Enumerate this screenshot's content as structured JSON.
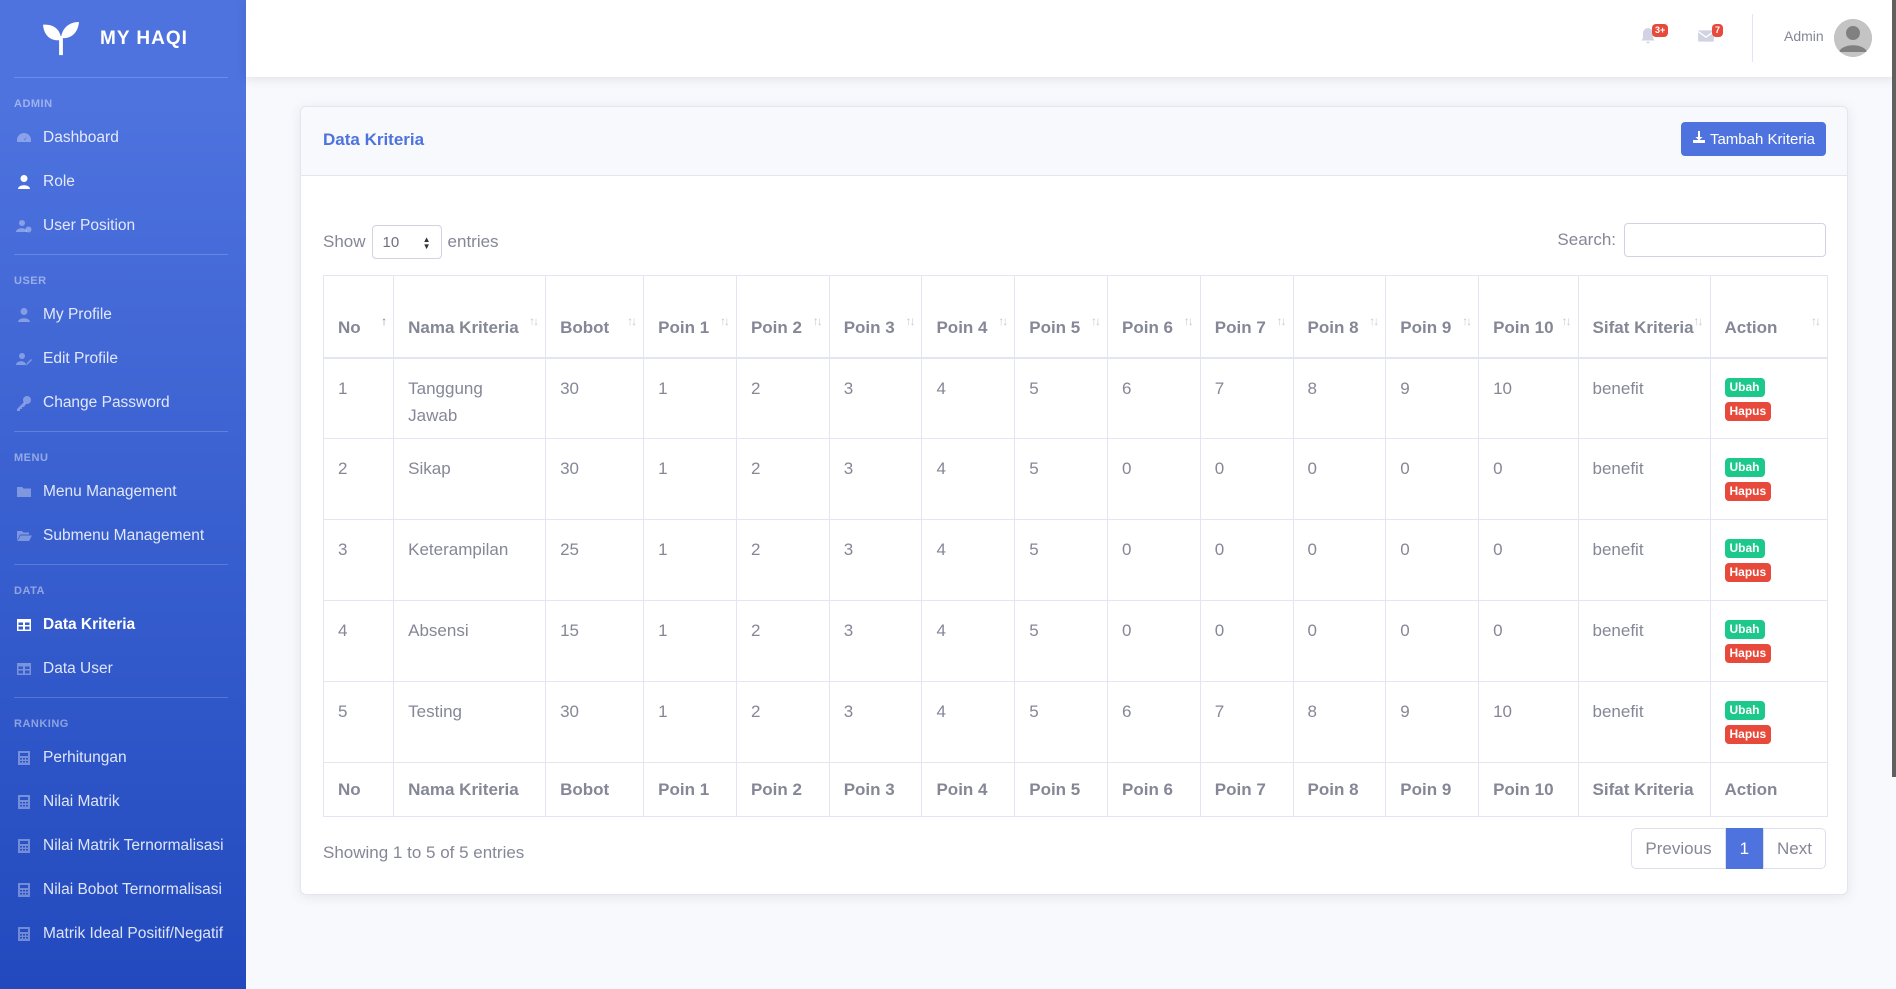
{
  "brand": {
    "name": "MY HAQI"
  },
  "sidebar": {
    "sections": [
      {
        "heading": "ADMIN",
        "items": [
          {
            "label": "Dashboard",
            "icon": "tachometer-icon"
          },
          {
            "label": "Role",
            "icon": "user-tie-icon"
          },
          {
            "label": "User Position",
            "icon": "users-cog-icon"
          }
        ]
      },
      {
        "heading": "USER",
        "items": [
          {
            "label": "My Profile",
            "icon": "user-icon"
          },
          {
            "label": "Edit Profile",
            "icon": "user-edit-icon"
          },
          {
            "label": "Change Password",
            "icon": "key-icon"
          }
        ]
      },
      {
        "heading": "MENU",
        "items": [
          {
            "label": "Menu Management",
            "icon": "folder-icon"
          },
          {
            "label": "Submenu Management",
            "icon": "folder-open-icon"
          }
        ]
      },
      {
        "heading": "DATA",
        "items": [
          {
            "label": "Data Kriteria",
            "icon": "table-icon"
          },
          {
            "label": "Data User",
            "icon": "table-icon"
          }
        ]
      },
      {
        "heading": "RANKING",
        "items": [
          {
            "label": "Perhitungan",
            "icon": "calculator-icon"
          },
          {
            "label": "Nilai Matrik",
            "icon": "calculator-icon"
          },
          {
            "label": "Nilai Matrik Ternormalisasi",
            "icon": "calculator-icon"
          },
          {
            "label": "Nilai Bobot Ternormalisasi",
            "icon": "calculator-icon"
          },
          {
            "label": "Matrik Ideal Positif/Negatif",
            "icon": "calculator-icon"
          }
        ]
      }
    ]
  },
  "topbar": {
    "alerts_badge": "3+",
    "messages_badge": "7",
    "user_name": "Admin"
  },
  "card": {
    "title": "Data Kriteria",
    "add_button": "Tambah Kriteria",
    "show_label": "Show",
    "entries_label": "entries",
    "page_length": "10",
    "search_label": "Search:",
    "search_value": ""
  },
  "table": {
    "headers": [
      "No",
      "Nama Kriteria",
      "Bobot",
      "Poin 1",
      "Poin 2",
      "Poin 3",
      "Poin 4",
      "Poin 5",
      "Poin 6",
      "Poin 7",
      "Poin 8",
      "Poin 9",
      "Poin 10",
      "Sifat Kriteria",
      "Action"
    ],
    "rows": [
      [
        "1",
        "Tanggung Jawab",
        "30",
        "1",
        "2",
        "3",
        "4",
        "5",
        "6",
        "7",
        "8",
        "9",
        "10",
        "benefit"
      ],
      [
        "2",
        "Sikap",
        "30",
        "1",
        "2",
        "3",
        "4",
        "5",
        "0",
        "0",
        "0",
        "0",
        "0",
        "benefit"
      ],
      [
        "3",
        "Keterampilan",
        "25",
        "1",
        "2",
        "3",
        "4",
        "5",
        "0",
        "0",
        "0",
        "0",
        "0",
        "benefit"
      ],
      [
        "4",
        "Absensi",
        "15",
        "1",
        "2",
        "3",
        "4",
        "5",
        "0",
        "0",
        "0",
        "0",
        "0",
        "benefit"
      ],
      [
        "5",
        "Testing",
        "30",
        "1",
        "2",
        "3",
        "4",
        "5",
        "6",
        "7",
        "8",
        "9",
        "10",
        "benefit"
      ]
    ],
    "edit_label": "Ubah",
    "delete_label": "Hapus"
  },
  "footer": {
    "info": "Showing 1 to 5 of 5 entries",
    "previous": "Previous",
    "current_page": "1",
    "next": "Next"
  },
  "colors": {
    "primary": "#4e73df",
    "success": "#1cc88a",
    "danger": "#e74a3b"
  }
}
